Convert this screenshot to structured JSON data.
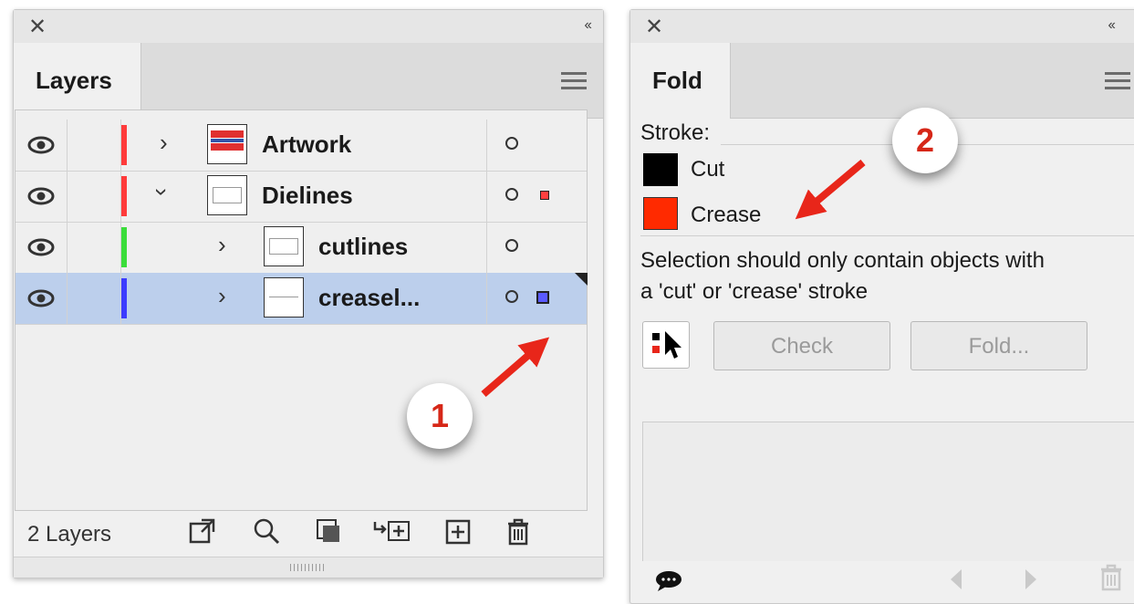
{
  "layers_panel": {
    "tab_label": "Layers",
    "close_glyph": "✕",
    "collapse_glyph": "‹‹",
    "rows": [
      {
        "name": "Artwork",
        "color": "#ff3b3b",
        "expanded": false,
        "selected": false
      },
      {
        "name": "Dielines",
        "color": "#ff3b3b",
        "expanded": true,
        "selected": false
      },
      {
        "name": "cutlines",
        "color": "#3bdd3b",
        "expanded": false,
        "selected": false
      },
      {
        "name": "creasel...",
        "color": "#3b3bff",
        "expanded": false,
        "selected": true
      }
    ],
    "footer": {
      "count_label": "2 Layers",
      "icons": [
        "export-icon",
        "search-icon",
        "clipping-mask-icon",
        "move-to-layer-icon",
        "new-layer-icon",
        "trash-icon"
      ]
    }
  },
  "fold_panel": {
    "tab_label": "Fold",
    "close_glyph": "✕",
    "collapse_glyph": "‹‹",
    "stroke_label": "Stroke:",
    "strokes": [
      {
        "label": "Cut",
        "color": "#000000"
      },
      {
        "label": "Crease",
        "color": "#ff2a00"
      }
    ],
    "message_line1": "Selection should only contain objects with",
    "message_line2": "a 'cut' or 'crease' stroke",
    "check_button": "Check",
    "fold_button": "Fold..."
  },
  "callouts": {
    "one": "1",
    "two": "2"
  },
  "colors": {
    "selected_row": "#bccfec",
    "callout_red": "#e8261a"
  }
}
